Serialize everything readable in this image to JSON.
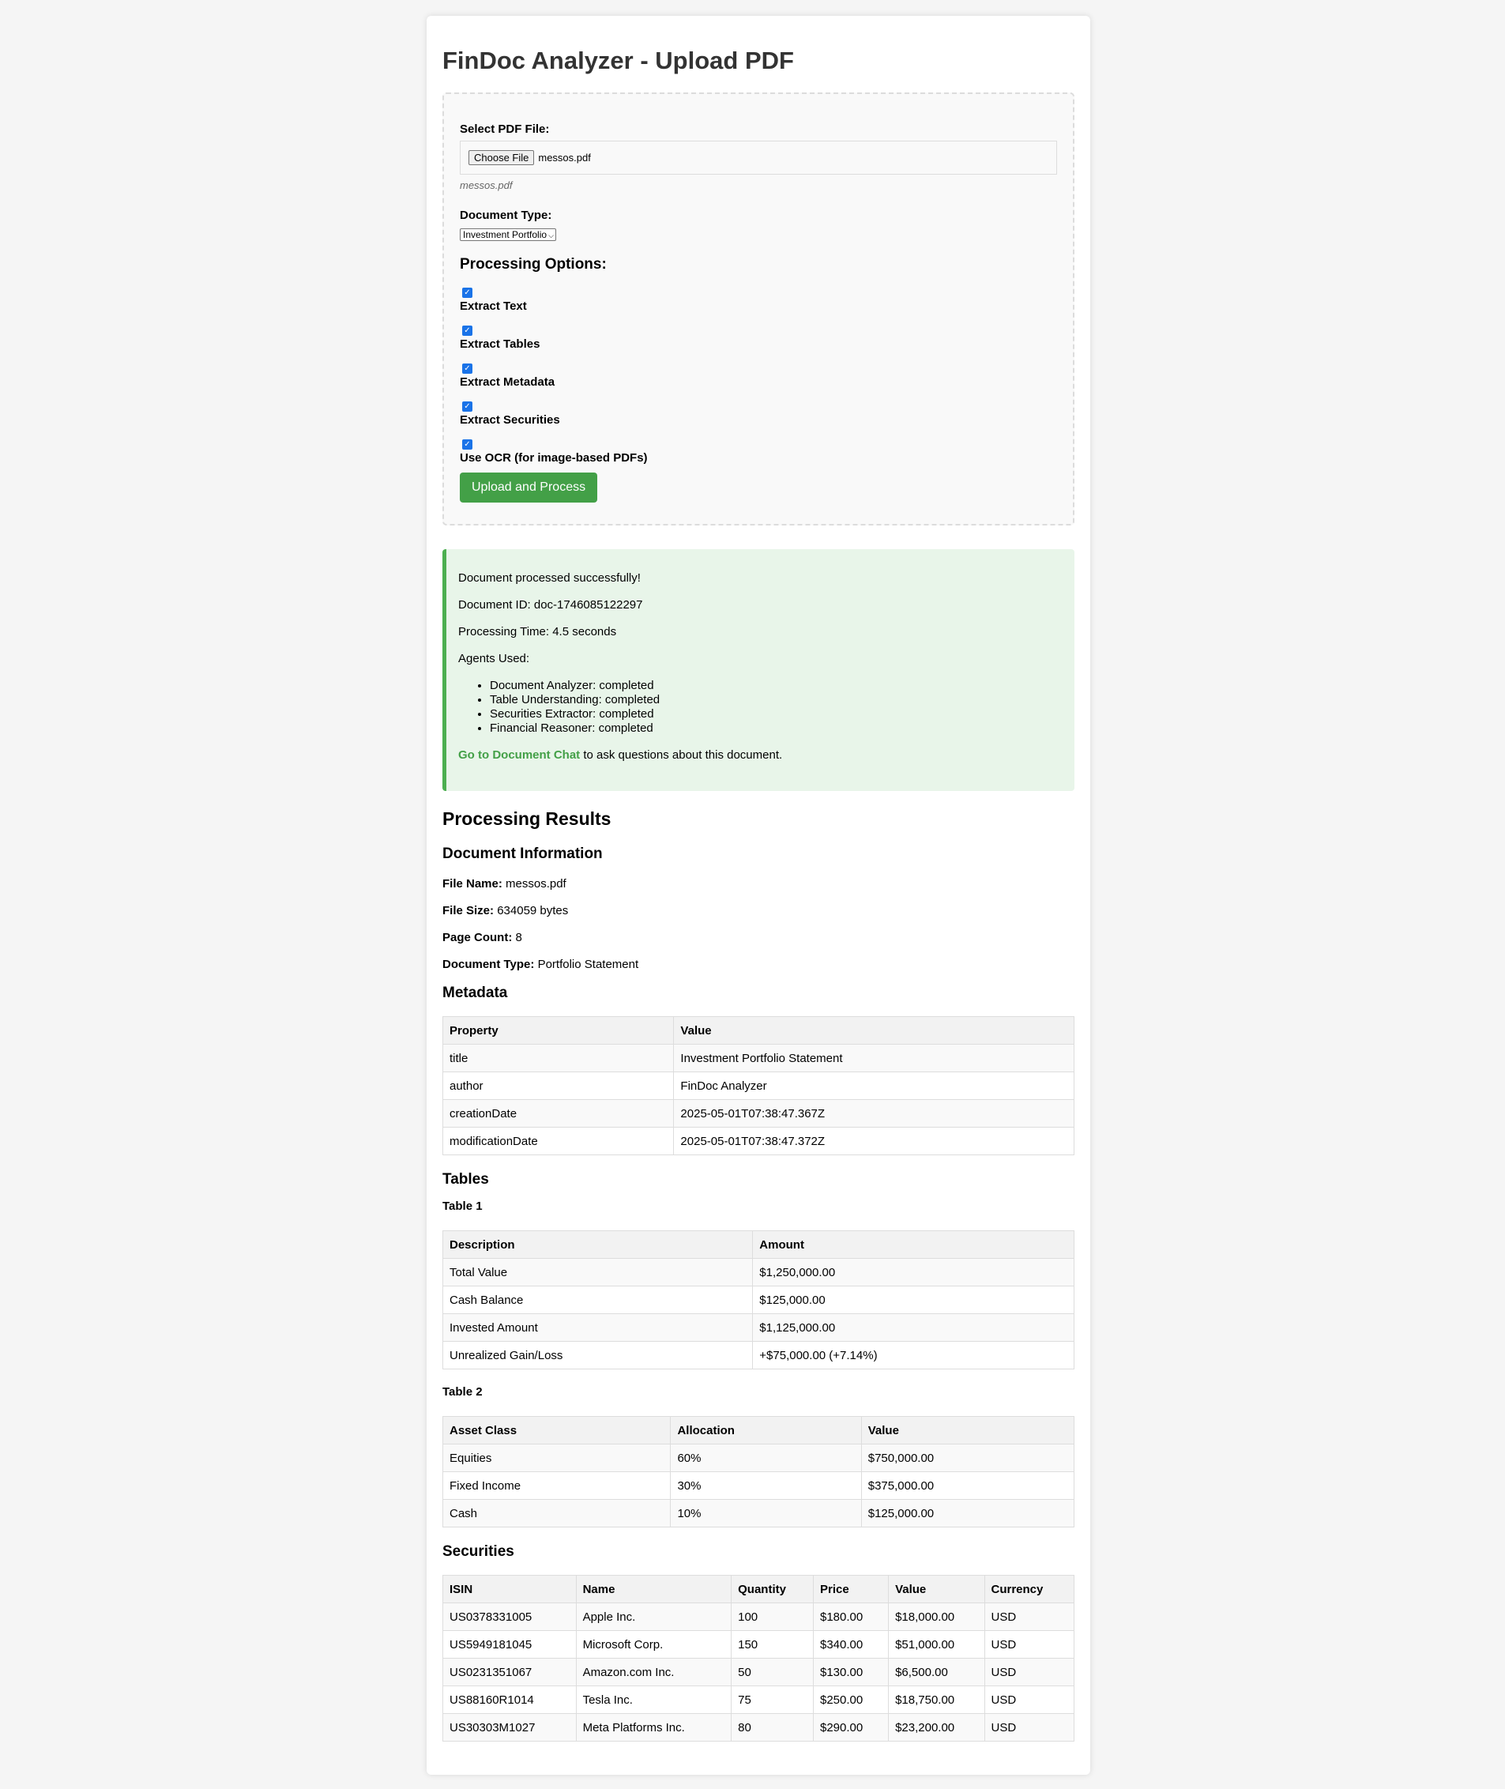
{
  "page": {
    "title": "FinDoc Analyzer - Upload PDF"
  },
  "upload": {
    "file_label": "Select PDF File:",
    "choose_button": "Choose File",
    "file_name": "messos.pdf",
    "file_hint": "messos.pdf",
    "doc_type_label": "Document Type:",
    "doc_type_selected": "Investment Portfolio",
    "options_title": "Processing Options:",
    "options": [
      {
        "label": "Extract Text",
        "checked": true
      },
      {
        "label": "Extract Tables",
        "checked": true
      },
      {
        "label": "Extract Metadata",
        "checked": true
      },
      {
        "label": "Extract Securities",
        "checked": true
      },
      {
        "label": "Use OCR (for image-based PDFs)",
        "checked": true
      }
    ],
    "submit_label": "Upload and Process"
  },
  "success": {
    "message": "Document processed successfully!",
    "doc_id": "Document ID: doc-1746085122297",
    "processing_time": "Processing Time: 4.5 seconds",
    "agents_title": "Agents Used:",
    "agents": [
      "Document Analyzer: completed",
      "Table Understanding: completed",
      "Securities Extractor: completed",
      "Financial Reasoner: completed"
    ],
    "chat_link": "Go to Document Chat",
    "chat_suffix": " to ask questions about this document.",
    "accent": "#4caf50"
  },
  "results": {
    "title": "Processing Results",
    "doc_info_title": "Document Information",
    "file_name_label": "File Name:",
    "file_name": " messos.pdf",
    "file_size_label": "File Size:",
    "file_size": " 634059 bytes",
    "page_count_label": "Page Count:",
    "page_count": " 8",
    "doc_type_label": "Document Type:",
    "doc_type": " Portfolio Statement",
    "metadata_title": "Metadata",
    "metadata_headers": [
      "Property",
      "Value"
    ],
    "metadata_rows": [
      [
        "title",
        "Investment Portfolio Statement"
      ],
      [
        "author",
        "FinDoc Analyzer"
      ],
      [
        "creationDate",
        "2025-05-01T07:38:47.367Z"
      ],
      [
        "modificationDate",
        "2025-05-01T07:38:47.372Z"
      ]
    ],
    "tables_title": "Tables",
    "table1_title": "Table 1",
    "table1_headers": [
      "Description",
      "Amount"
    ],
    "table1_rows": [
      [
        "Total Value",
        "$1,250,000.00"
      ],
      [
        "Cash Balance",
        "$125,000.00"
      ],
      [
        "Invested Amount",
        "$1,125,000.00"
      ],
      [
        "Unrealized Gain/Loss",
        "+$75,000.00 (+7.14%)"
      ]
    ],
    "table2_title": "Table 2",
    "table2_headers": [
      "Asset Class",
      "Allocation",
      "Value"
    ],
    "table2_rows": [
      [
        "Equities",
        "60%",
        "$750,000.00"
      ],
      [
        "Fixed Income",
        "30%",
        "$375,000.00"
      ],
      [
        "Cash",
        "10%",
        "$125,000.00"
      ]
    ],
    "securities_title": "Securities",
    "securities_headers": [
      "ISIN",
      "Name",
      "Quantity",
      "Price",
      "Value",
      "Currency"
    ],
    "securities_rows": [
      [
        "US0378331005",
        "Apple Inc.",
        "100",
        "$180.00",
        "$18,000.00",
        "USD"
      ],
      [
        "US5949181045",
        "Microsoft Corp.",
        "150",
        "$340.00",
        "$51,000.00",
        "USD"
      ],
      [
        "US0231351067",
        "Amazon.com Inc.",
        "50",
        "$130.00",
        "$6,500.00",
        "USD"
      ],
      [
        "US88160R1014",
        "Tesla Inc.",
        "75",
        "$250.00",
        "$18,750.00",
        "USD"
      ],
      [
        "US30303M1027",
        "Meta Platforms Inc.",
        "80",
        "$290.00",
        "$23,200.00",
        "USD"
      ]
    ]
  }
}
